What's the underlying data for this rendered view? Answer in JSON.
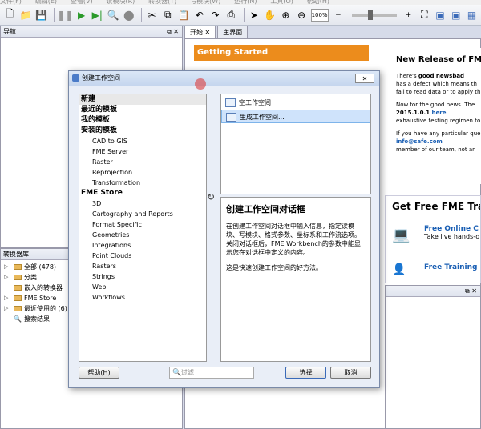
{
  "menubar": {
    "items": [
      "文件(F)",
      "编辑(E)",
      "查看(V)",
      "读模块(R)",
      "转换器(T)",
      "写模块(W)",
      "运行(N)",
      "工具(O)",
      "帮助(H)"
    ]
  },
  "toolbar": {
    "zoom_value": "100%"
  },
  "panels": {
    "navigator_title": "导航",
    "transformer_gallery_title": "转换器库",
    "gallery_items": [
      {
        "label": "全部 (478)"
      },
      {
        "label": "分类"
      },
      {
        "label": "嵌入的转换器"
      },
      {
        "label": "FME Store"
      },
      {
        "label": "最近使用的 (6)"
      },
      {
        "label": "搜索结果"
      }
    ]
  },
  "tabs": [
    {
      "label": "开始"
    },
    {
      "label": "主界面"
    }
  ],
  "getting_started": "Getting Started",
  "news": {
    "title": "New Release of FME",
    "p1a": "There's ",
    "p1b": "good news",
    " p1c": " and ",
    "p1d": "bad",
    "p1e": "has a defect which means th",
    "p1f": "fail to read data or to apply th",
    "p2a": "Now for the good news. The",
    "p2b": "2015.1.0.1 ",
    "p2link": "here",
    ". p2c": ". We apologi",
    "p2d": "exhaustive testing regimen to",
    "p3a": "If you have any particular que",
    "p3link": "info@safe.com",
    " p3b": " and you'll re",
    "p3c": "member of our team, not an"
  },
  "training": {
    "title": "Get Free FME Tra",
    "online_link": "Free Online C",
    "online_desc": "Take live hands-o",
    "training_link": "Free Training"
  },
  "dialog": {
    "title": "创建工作空间",
    "close": "✕",
    "categories": [
      {
        "label": "新建",
        "bold": true,
        "indent": false,
        "selected": true
      },
      {
        "label": "最近的模板",
        "bold": true,
        "indent": false
      },
      {
        "label": "我的模板",
        "bold": true,
        "indent": false
      },
      {
        "label": "安装的模板",
        "bold": true,
        "indent": false
      },
      {
        "label": "CAD to GIS",
        "bold": false,
        "indent": true
      },
      {
        "label": "FME Server",
        "bold": false,
        "indent": true
      },
      {
        "label": "Raster",
        "bold": false,
        "indent": true
      },
      {
        "label": "Reprojection",
        "bold": false,
        "indent": true
      },
      {
        "label": "Transformation",
        "bold": false,
        "indent": true
      },
      {
        "label": "FME Store",
        "bold": true,
        "indent": false
      },
      {
        "label": "3D",
        "bold": false,
        "indent": true
      },
      {
        "label": "Cartography and Reports",
        "bold": false,
        "indent": true
      },
      {
        "label": "Format Specific",
        "bold": false,
        "indent": true
      },
      {
        "label": "Geometries",
        "bold": false,
        "indent": true
      },
      {
        "label": "Integrations",
        "bold": false,
        "indent": true
      },
      {
        "label": "Point Clouds",
        "bold": false,
        "indent": true
      },
      {
        "label": "Rasters",
        "bold": false,
        "indent": true
      },
      {
        "label": "Strings",
        "bold": false,
        "indent": true
      },
      {
        "label": "Web",
        "bold": false,
        "indent": true
      },
      {
        "label": "Workflows",
        "bold": false,
        "indent": true
      }
    ],
    "templates": [
      {
        "label": "空工作空间",
        "selected": false
      },
      {
        "label": "生成工作空间...",
        "selected": true
      }
    ],
    "desc_title": "创建工作空间对话框",
    "desc_p1": "在创建工作空间对话框中输入信息，指定读模块、写模块、格式参数、坐标系和工作流选项。关闭对话框后，FME Workbench的参数中能显示您在对话框中定义的内容。",
    "desc_p2": "这是快速创建工作空间的好方法。",
    "help_button": "帮助(H)",
    "filter_placeholder": "过滤",
    "select_button": "选择",
    "cancel_button": "取消"
  }
}
